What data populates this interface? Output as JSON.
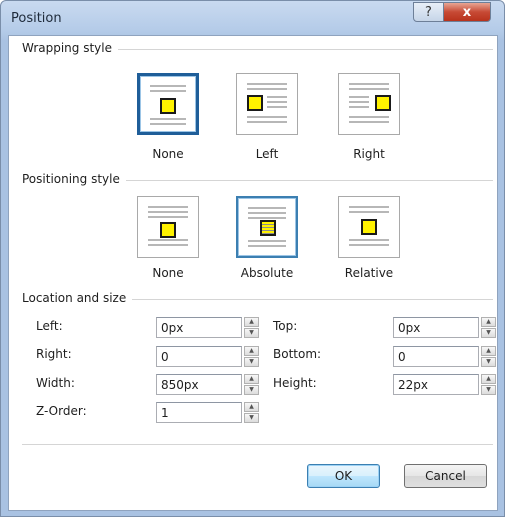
{
  "window": {
    "title": "Position"
  },
  "titlebar": {
    "help_glyph": "?",
    "close_glyph": "x"
  },
  "wrapping": {
    "heading": "Wrapping style",
    "options": [
      {
        "label": "None",
        "icon": "wrap-none-icon",
        "selected": true
      },
      {
        "label": "Left",
        "icon": "wrap-left-icon",
        "selected": false
      },
      {
        "label": "Right",
        "icon": "wrap-right-icon",
        "selected": false
      }
    ]
  },
  "positioning": {
    "heading": "Positioning style",
    "options": [
      {
        "label": "None",
        "icon": "position-none-icon",
        "selected": false
      },
      {
        "label": "Absolute",
        "icon": "position-absolute-icon",
        "selected": true
      },
      {
        "label": "Relative",
        "icon": "position-relative-icon",
        "selected": false
      }
    ]
  },
  "location": {
    "heading": "Location and size",
    "left": {
      "label": "Left:",
      "value": "0px"
    },
    "top": {
      "label": "Top:",
      "value": "0px"
    },
    "right": {
      "label": "Right:",
      "value": "0"
    },
    "bottom": {
      "label": "Bottom:",
      "value": "0"
    },
    "width": {
      "label": "Width:",
      "value": "850px"
    },
    "height": {
      "label": "Height:",
      "value": "22px"
    },
    "zorder": {
      "label": "Z-Order:",
      "value": "1"
    }
  },
  "buttons": {
    "ok": "OK",
    "cancel": "Cancel"
  },
  "colors": {
    "accent": "#3c7fb1",
    "square": "#fff200",
    "close": "#c74a35"
  }
}
